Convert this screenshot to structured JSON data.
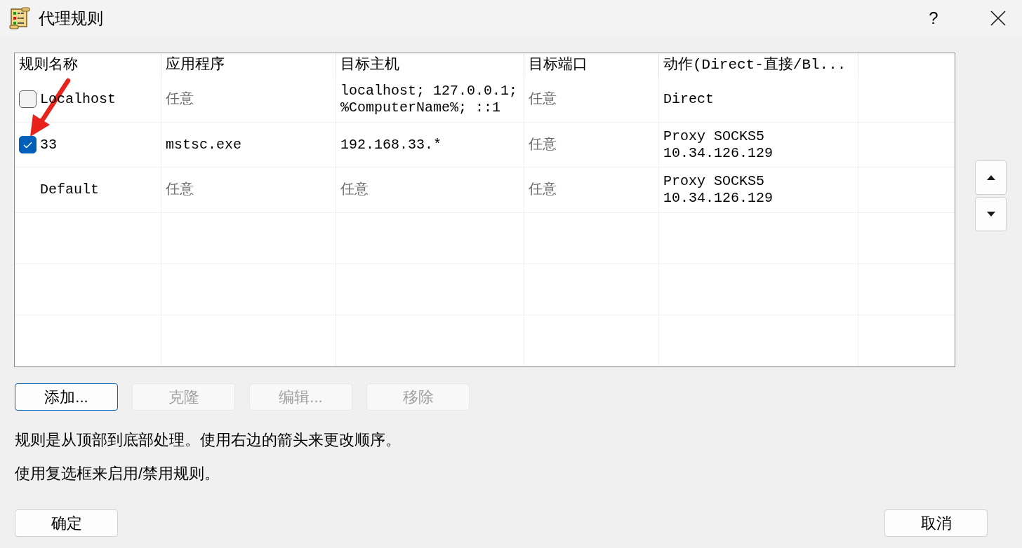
{
  "window": {
    "title": "代理规则",
    "help": "?"
  },
  "table": {
    "columns": [
      "规则名称",
      "应用程序",
      "目标主机",
      "目标端口",
      "动作(Direct-直接/Bl..."
    ],
    "rows": [
      {
        "kind": "rule",
        "checked": false,
        "cells": [
          {
            "text": "Localhost",
            "dimmed": false
          },
          {
            "text": "任意",
            "dimmed": true
          },
          {
            "text": "localhost; 127.0.0.1;\n%ComputerName%; ::1",
            "dimmed": false
          },
          {
            "text": "任意",
            "dimmed": true
          },
          {
            "text": "Direct",
            "dimmed": false
          }
        ]
      },
      {
        "kind": "rule",
        "checked": true,
        "cells": [
          {
            "text": "33",
            "dimmed": false
          },
          {
            "text": "mstsc.exe",
            "dimmed": false
          },
          {
            "text": "192.168.33.*",
            "dimmed": false
          },
          {
            "text": "任意",
            "dimmed": true
          },
          {
            "text": "Proxy SOCKS5\n10.34.126.129",
            "dimmed": false
          }
        ]
      },
      {
        "kind": "default",
        "cells": [
          {
            "text": "Default",
            "dimmed": false
          },
          {
            "text": "任意",
            "dimmed": true
          },
          {
            "text": "任意",
            "dimmed": true
          },
          {
            "text": "任意",
            "dimmed": true
          },
          {
            "text": "Proxy SOCKS5\n10.34.126.129",
            "dimmed": false
          }
        ]
      }
    ]
  },
  "actions": [
    {
      "label": "添加...",
      "focused": true,
      "disabled": false
    },
    {
      "label": "克隆",
      "focused": false,
      "disabled": true
    },
    {
      "label": "编辑...",
      "focused": false,
      "disabled": true
    },
    {
      "label": "移除",
      "focused": false,
      "disabled": true
    }
  ],
  "hints": [
    "规则是从顶部到底部处理。使用右边的箭头来更改顺序。",
    "使用复选框来启用/禁用规则。"
  ],
  "confirm": {
    "label": "确定"
  },
  "cancel": {
    "label": "取消"
  }
}
